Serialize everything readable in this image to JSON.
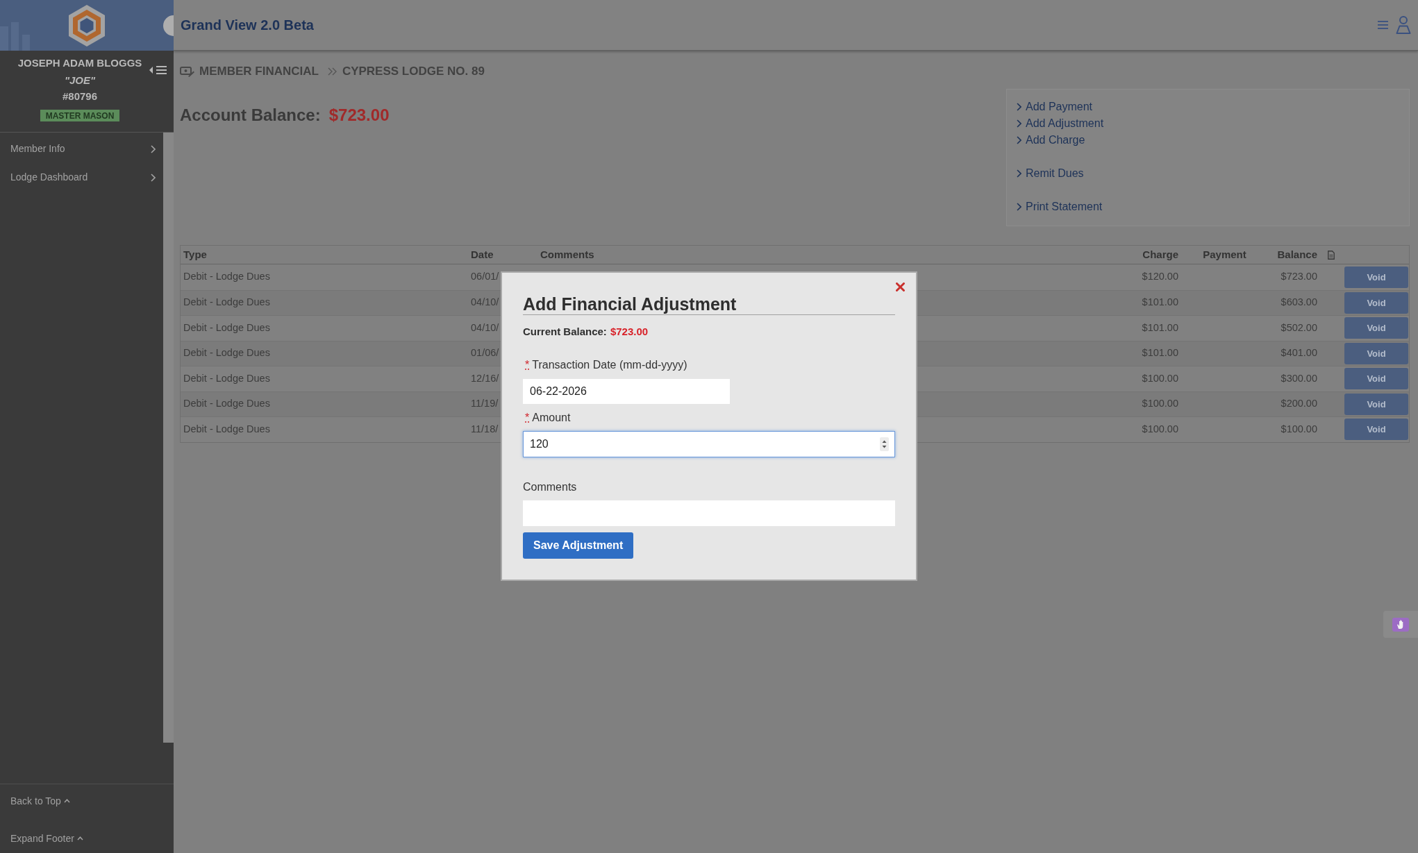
{
  "sidebar": {
    "profile": {
      "name": "JOSEPH ADAM BLOGGS",
      "nickname": "\"JOE\"",
      "member_number": "#80796",
      "degree": "MASTER MASON"
    },
    "items": [
      {
        "label": "Member Info"
      },
      {
        "label": "Lodge Dashboard"
      }
    ],
    "footer_links": [
      {
        "label": "Back to Top"
      },
      {
        "label": "Expand Footer"
      }
    ]
  },
  "header": {
    "title": "Grand View 2.0 Beta"
  },
  "breadcrumb": [
    "MEMBER FINANCIAL",
    "CYPRESS LODGE NO. 89"
  ],
  "account_balance": {
    "label": "Account Balance:",
    "value": "$723.00"
  },
  "action_groups": [
    {
      "links": [
        "Add Payment",
        "Add Adjustment",
        "Add Charge"
      ]
    },
    {
      "links": [
        "Remit Dues"
      ]
    },
    {
      "links": [
        "Print Statement"
      ]
    }
  ],
  "table": {
    "columns": [
      "Type",
      "Date",
      "Comments",
      "Charge",
      "Payment",
      "Balance"
    ],
    "rows": [
      {
        "type": "Debit - Lodge Dues",
        "date": "06/01/",
        "charge": "$120.00",
        "balance": "$723.00",
        "action": "Void"
      },
      {
        "type": "Debit - Lodge Dues",
        "date": "04/10/",
        "charge": "$101.00",
        "balance": "$603.00",
        "action": "Void"
      },
      {
        "type": "Debit - Lodge Dues",
        "date": "04/10/",
        "charge": "$101.00",
        "balance": "$502.00",
        "action": "Void"
      },
      {
        "type": "Debit - Lodge Dues",
        "date": "01/06/",
        "charge": "$101.00",
        "balance": "$401.00",
        "action": "Void"
      },
      {
        "type": "Debit - Lodge Dues",
        "date": "12/16/",
        "charge": "$100.00",
        "balance": "$300.00",
        "action": "Void"
      },
      {
        "type": "Debit - Lodge Dues",
        "date": "11/19/",
        "charge": "$100.00",
        "balance": "$200.00",
        "action": "Void"
      },
      {
        "type": "Debit - Lodge Dues",
        "date": "11/18/",
        "charge": "$100.00",
        "balance": "$100.00",
        "action": "Void"
      }
    ]
  },
  "dialog": {
    "title": "Add Financial Adjustment",
    "balance_label": "Current Balance:",
    "balance_value": "$723.00",
    "fields": [
      {
        "kind": "date",
        "required_mark": "*",
        "label": "Transaction Date (mm-dd-yyyy)",
        "value": "06-22-2026",
        "focused": false
      },
      {
        "kind": "number",
        "required_mark": "*",
        "label": "Amount",
        "value": "120",
        "focused": true
      },
      {
        "kind": "text",
        "label": "Comments",
        "focused": false
      }
    ],
    "submit": "Save Adjustment"
  }
}
